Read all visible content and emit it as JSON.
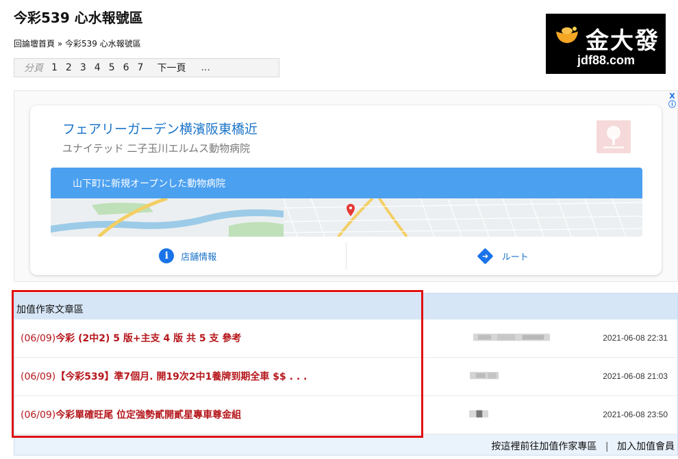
{
  "page": {
    "title": "今彩539 心水報號區"
  },
  "breadcrumb": {
    "home": "回論壇首頁",
    "separator": "»",
    "current": "今彩539 心水報號區"
  },
  "pager": {
    "label": "分頁",
    "pages": [
      "1",
      "2",
      "3",
      "4",
      "5",
      "6",
      "7"
    ],
    "next": "下一頁",
    "more": "..."
  },
  "logo": {
    "name": "金大發",
    "domain": "jdf88.com"
  },
  "ad": {
    "title": "フェアリーガーデン横濱阪東橋近",
    "subtitle": "ユナイテッド 二子玉川エルムス動物病院",
    "banner": "山下町に新規オープンした動物病院",
    "action_info": "店舗情報",
    "action_route": "ルート",
    "badge_close": "X",
    "badge_info": "ⓘ",
    "info_glyph": "i",
    "route_glyph": "➜"
  },
  "articles": {
    "header": "加值作家文章區",
    "rows": [
      {
        "prefix": "(06/09)",
        "title": "今彩 (2中2) 5 版+主支 4 版 共 5 支 參考",
        "date": "2021-06-08 22:31"
      },
      {
        "prefix": "(06/09)",
        "title": "【今彩539】準7個月. 開19次2中1養牌到期全車 $$ . . .",
        "date": "2021-06-08 21:03"
      },
      {
        "prefix": "(06/09)",
        "title": "今彩單確旺尾 位定強勢貳開貳星專車尊金組",
        "date": "2021-06-08 23:50"
      }
    ],
    "footer_link": "按這裡前往加值作家專區",
    "footer_sep": "|",
    "footer_join": "加入加值會員"
  },
  "colors": {
    "accent_red": "#b5161b",
    "header_blue": "#d6e6f6",
    "ad_blue": "#1a73c8",
    "highlight_outline": "#e01010"
  }
}
